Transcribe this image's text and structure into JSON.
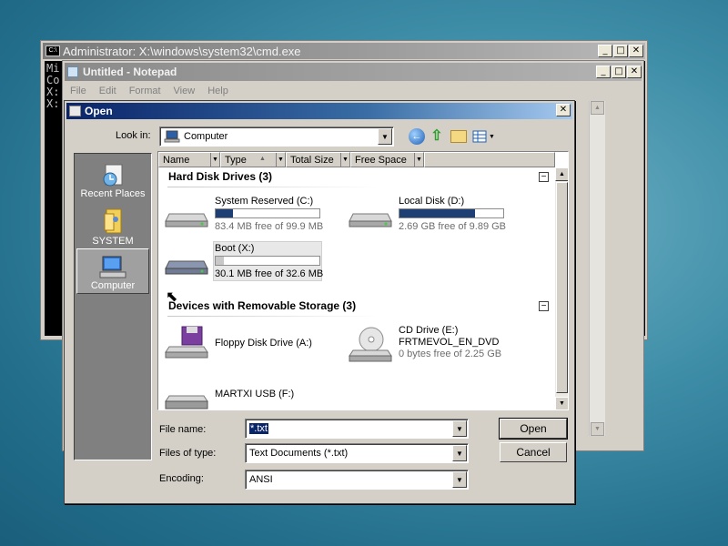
{
  "cmd": {
    "title": "Administrator: X:\\windows\\system32\\cmd.exe",
    "lines": [
      "Mi",
      "Co",
      "",
      "X:",
      "",
      "X:"
    ]
  },
  "notepad": {
    "title": "Untitled - Notepad",
    "menu": [
      "File",
      "Edit",
      "Format",
      "View",
      "Help"
    ]
  },
  "dialog": {
    "title": "Open",
    "look_in_label": "Look in:",
    "look_in_value": "Computer",
    "places": [
      {
        "label": "Recent Places",
        "icon": "recent-places-icon"
      },
      {
        "label": "SYSTEM",
        "icon": "user-folder-icon"
      },
      {
        "label": "Computer",
        "icon": "computer-icon"
      }
    ],
    "columns": [
      "Name",
      "Type",
      "Total Size",
      "Free Space"
    ],
    "groups": {
      "hdd": "Hard Disk Drives (3)",
      "removable": "Devices with Removable Storage (3)"
    },
    "drives": {
      "c": {
        "name": "System Reserved (C:)",
        "free": "83.4 MB free of 99.9 MB",
        "used_fraction": 0.17
      },
      "d": {
        "name": "Local Disk (D:)",
        "free": "2.69 GB free of 9.89 GB",
        "used_fraction": 0.73
      },
      "x": {
        "name": "Boot (X:)",
        "free": "30.1 MB free of 32.6 MB",
        "used_fraction": 0.08
      },
      "a": {
        "name": "Floppy Disk Drive (A:)"
      },
      "e": {
        "name": "CD Drive (E:)",
        "label": "FRTMEVOL_EN_DVD",
        "free": "0 bytes free of 2.25 GB"
      },
      "f": {
        "name": "MARTXI USB (F:)"
      }
    },
    "file_name_label": "File name:",
    "file_name_value": "*.txt",
    "file_type_label": "Files of type:",
    "file_type_value": "Text Documents (*.txt)",
    "encoding_label": "Encoding:",
    "encoding_value": "ANSI",
    "open_button": "Open",
    "cancel_button": "Cancel"
  }
}
